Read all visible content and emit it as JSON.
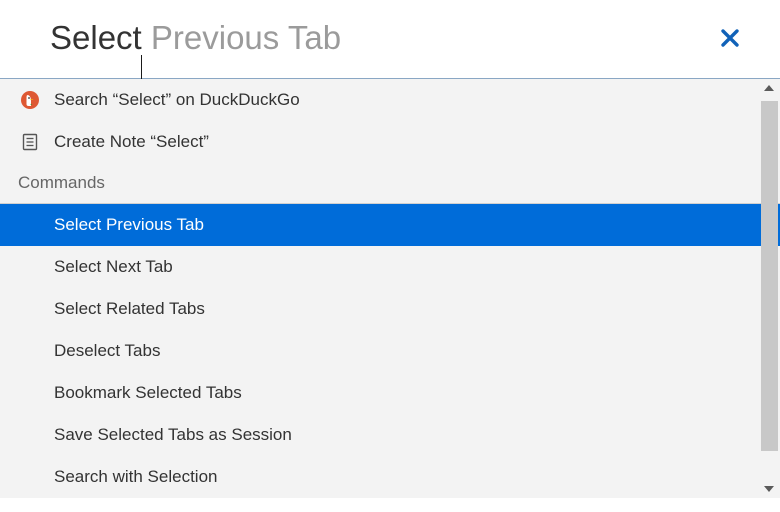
{
  "search": {
    "typed": "Select",
    "completion": " Previous Tab"
  },
  "actions": {
    "search_engine": "Search “Select” on DuckDuckGo",
    "create_note": "Create Note “Select”"
  },
  "commands_header": "Commands",
  "commands": [
    {
      "label": "Select Previous Tab",
      "selected": true
    },
    {
      "label": "Select Next Tab",
      "selected": false
    },
    {
      "label": "Select Related Tabs",
      "selected": false
    },
    {
      "label": "Deselect Tabs",
      "selected": false
    },
    {
      "label": "Bookmark Selected Tabs",
      "selected": false
    },
    {
      "label": "Save Selected Tabs as Session",
      "selected": false
    },
    {
      "label": "Search with Selection",
      "selected": false
    }
  ],
  "colors": {
    "selection": "#006cd9",
    "close_icon": "#1162b8",
    "ghost_text": "#9b9b9b",
    "divider": "#8aa7c4",
    "list_bg": "#f3f3f3"
  }
}
